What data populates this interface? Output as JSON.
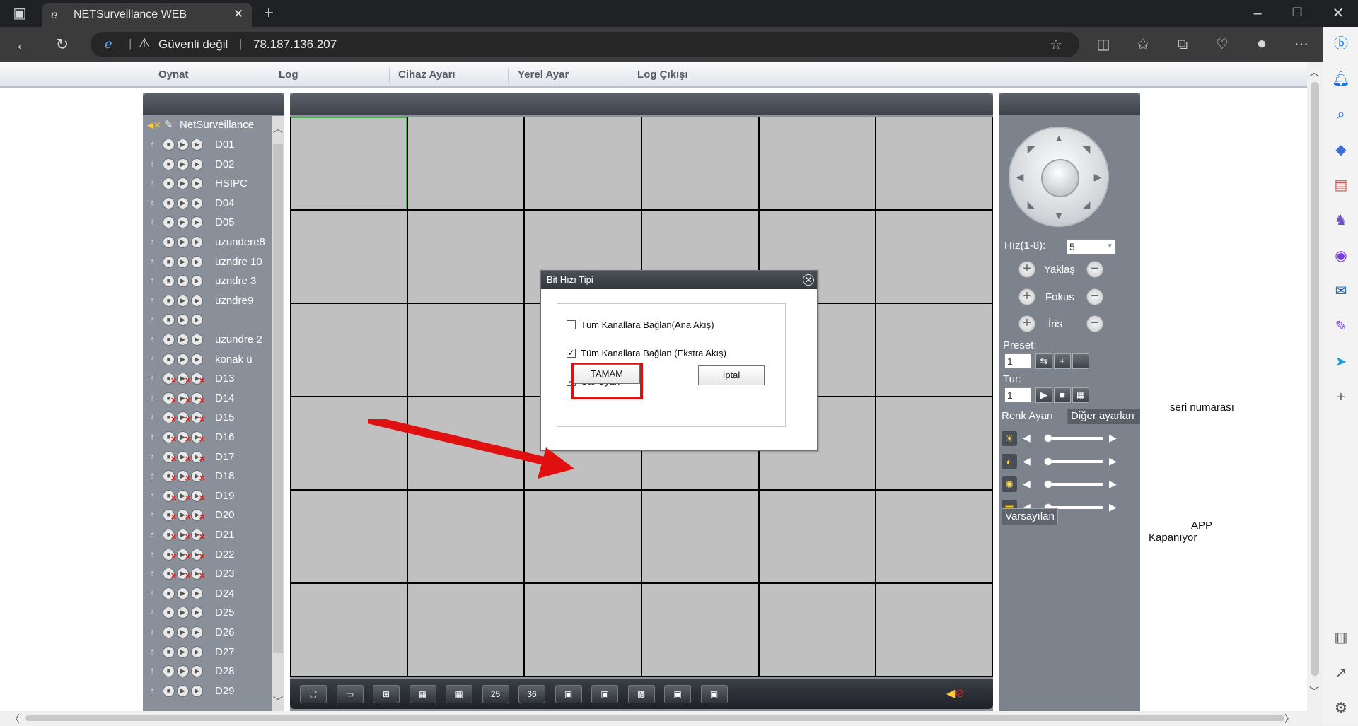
{
  "browser": {
    "tab_title": "NETSurveillance WEB",
    "security_label": "Güvenli değil",
    "url": "78.187.136.207"
  },
  "menu": {
    "items": [
      "Oynat",
      "Log",
      "Cihaz Ayarı",
      "Yerel Ayar",
      "Log Çıkışı"
    ]
  },
  "device_tree": {
    "root": "NetSurveillance",
    "devices": [
      {
        "name": "D01",
        "offline": false
      },
      {
        "name": "D02",
        "offline": false
      },
      {
        "name": "HSIPC",
        "offline": false
      },
      {
        "name": "D04",
        "offline": false
      },
      {
        "name": "D05",
        "offline": false
      },
      {
        "name": "uzundere8",
        "offline": false
      },
      {
        "name": "uzndre 10",
        "offline": false
      },
      {
        "name": "uzndre 3",
        "offline": false
      },
      {
        "name": "uzndre9",
        "offline": false
      },
      {
        "name": "",
        "offline": false
      },
      {
        "name": "uzundre 2",
        "offline": false
      },
      {
        "name": "konak ü",
        "offline": false
      },
      {
        "name": "D13",
        "offline": true
      },
      {
        "name": "D14",
        "offline": true
      },
      {
        "name": "D15",
        "offline": true
      },
      {
        "name": "D16",
        "offline": true
      },
      {
        "name": "D17",
        "offline": true
      },
      {
        "name": "D18",
        "offline": true
      },
      {
        "name": "D19",
        "offline": true
      },
      {
        "name": "D20",
        "offline": true
      },
      {
        "name": "D21",
        "offline": true
      },
      {
        "name": "D22",
        "offline": true
      },
      {
        "name": "D23",
        "offline": true
      },
      {
        "name": "D24",
        "offline": false
      },
      {
        "name": "D25",
        "offline": false
      },
      {
        "name": "D26",
        "offline": false
      },
      {
        "name": "D27",
        "offline": false
      },
      {
        "name": "D28",
        "offline": false
      },
      {
        "name": "D29",
        "offline": false
      }
    ]
  },
  "toolbar": {
    "buttons": [
      {
        "icon": "fullscreen-icon",
        "label": ""
      },
      {
        "icon": "single-view-icon",
        "label": ""
      },
      {
        "icon": "quad-view-icon",
        "label": ""
      },
      {
        "icon": "nine-view-icon",
        "label": ""
      },
      {
        "icon": "sixteen-view-icon",
        "label": ""
      },
      {
        "icon": "view-25-icon",
        "label": "25"
      },
      {
        "icon": "view-36-icon",
        "label": "36"
      },
      {
        "icon": "open-all-icon",
        "label": ""
      },
      {
        "icon": "close-all-icon",
        "label": ""
      },
      {
        "icon": "snapshot-icon",
        "label": ""
      },
      {
        "icon": "record-all-icon",
        "label": ""
      },
      {
        "icon": "stop-record-icon",
        "label": ""
      }
    ]
  },
  "ptz": {
    "speed_label": "Hız(1-8):",
    "speed_value": "5",
    "zoom_label": "Yaklaş",
    "focus_label": "Fokus",
    "iris_label": "İris",
    "preset_label": "Preset:",
    "preset_value": "1",
    "tour_label": "Tur:",
    "tour_value": "1",
    "tab_color": "Renk Ayarı",
    "tab_other": "Diğer ayarları",
    "default_button": "Varsayılan",
    "sliders": [
      {
        "icon": "brightness-icon",
        "level": 0.0
      },
      {
        "icon": "contrast-icon",
        "level": 0.0
      },
      {
        "icon": "saturation-icon",
        "level": 0.0
      },
      {
        "icon": "hue-icon",
        "level": 0.0
      }
    ]
  },
  "notes": {
    "serial": "seri numarası",
    "app_line1": "APP",
    "app_line2": "Kapanıyor"
  },
  "dialog": {
    "title": "Bit Hızı Tipi",
    "options": [
      {
        "label": "Tüm Kanallara Bağlan(Ana Akış)",
        "checked": false
      },
      {
        "label": "Tüm Kanallara Bağlan (Ekstra Akış)",
        "checked": true
      },
      {
        "label": "Oto Uyarı",
        "checked": true
      }
    ],
    "ok_label": "TAMAM",
    "cancel_label": "İptal"
  },
  "colors": {
    "highlight": "#e01010",
    "arrow": "#e01010",
    "offline_mark": "#e0201c"
  }
}
